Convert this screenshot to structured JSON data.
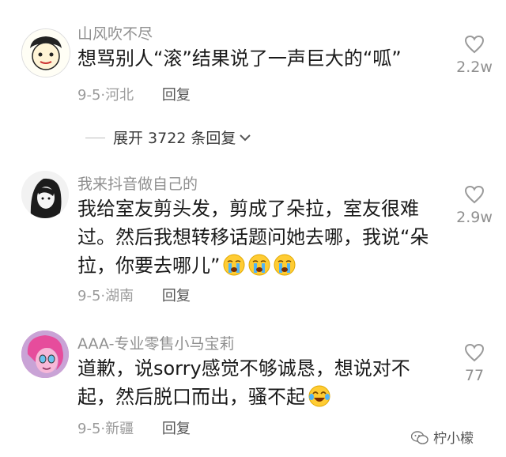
{
  "comments": [
    {
      "username": "山风吹不尽",
      "text": "想骂别人“滚”结果说了一声巨大的“呱”",
      "date": "9-5",
      "location": "河北",
      "reply_label": "回复",
      "likes": "2.2w"
    },
    {
      "username": "我来抖音做自己的",
      "text": "我给室友剪头发，剪成了朵拉，室友很难过。然后我想转移话题问她去哪，我说“朵拉，你要去哪儿”",
      "emojis": [
        "crying-face-emoji",
        "crying-face-emoji",
        "crying-face-emoji"
      ],
      "date": "9-5",
      "location": "湖南",
      "reply_label": "回复",
      "likes": "2.9w"
    },
    {
      "username": "AAA-专业零售小马宝莉",
      "text": "道歉，说sorry感觉不够诚恳，想说对不起，然后脱口而出，骚不起",
      "emojis": [
        "tears-of-joy-emoji"
      ],
      "date": "9-5",
      "location": "新疆",
      "reply_label": "回复",
      "likes": "77"
    }
  ],
  "expand": {
    "label": "展开 3722 条回复"
  },
  "watermark": {
    "text": "柠小檬"
  },
  "colors": {
    "username": "#8f8f8f",
    "text": "#1a1a1a",
    "meta": "#9b9b9b"
  }
}
